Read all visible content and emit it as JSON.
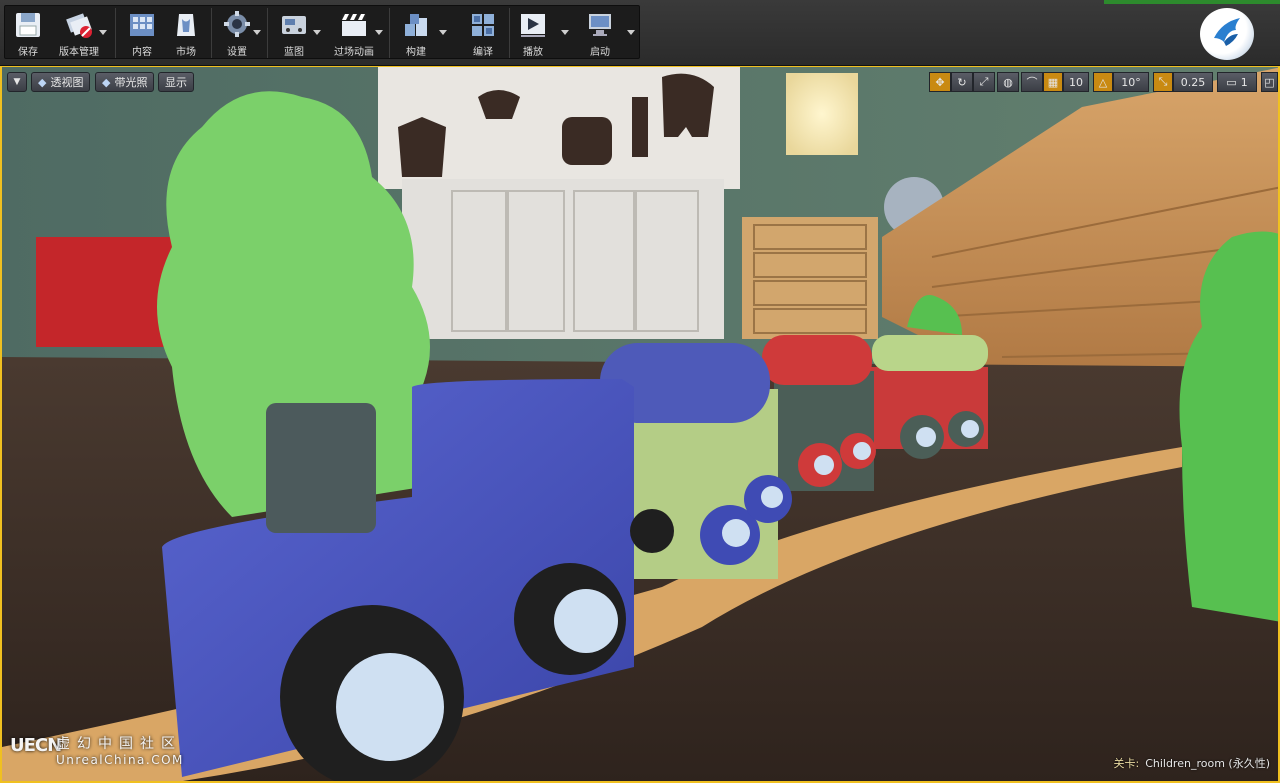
{
  "toolbar": {
    "buttons": [
      {
        "label": "保存",
        "icon": "save-icon"
      },
      {
        "label": "版本管理",
        "icon": "source-control-icon"
      },
      {
        "label": "内容",
        "icon": "content-icon"
      },
      {
        "label": "市场",
        "icon": "marketplace-icon"
      },
      {
        "label": "设置",
        "icon": "settings-icon"
      },
      {
        "label": "蓝图",
        "icon": "blueprint-icon"
      },
      {
        "label": "过场动画",
        "icon": "cinematics-icon"
      },
      {
        "label": "构建",
        "icon": "build-icon"
      },
      {
        "label": "编译",
        "icon": "compile-icon"
      },
      {
        "label": "播放",
        "icon": "play-icon"
      },
      {
        "label": "启动",
        "icon": "launch-icon"
      }
    ]
  },
  "viewport": {
    "options_icon": "dropdown-icon",
    "perspective_label": "透视图",
    "lit_label": "带光照",
    "show_label": "显示",
    "grid_snap": "10",
    "rotation_snap": "10°",
    "scale_snap": "0.25",
    "camera_speed": "1",
    "level_label": "关卡:",
    "level_name": "Children_room (永久性)"
  },
  "watermark": {
    "logo": "UECN",
    "cn": "虚幻中国社区",
    "en": "UnrealChina.COM"
  },
  "colors": {
    "viewport_border": "#f0c020",
    "snap_active": "#c98a12"
  }
}
